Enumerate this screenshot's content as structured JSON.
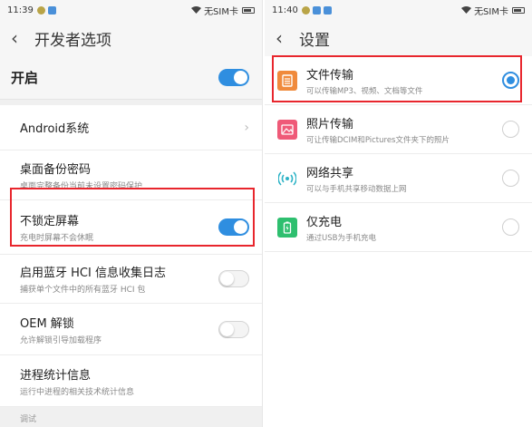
{
  "left": {
    "status": {
      "time": "11:39",
      "sim": "无SIM卡"
    },
    "header": {
      "title": "开发者选项"
    },
    "master": {
      "label": "开启",
      "enabled": true
    },
    "items": [
      {
        "title": "Android系统",
        "subtitle": ""
      },
      {
        "title": "桌面备份密码",
        "subtitle": "桌面完整备份当前未设置密码保护"
      },
      {
        "title": "不锁定屏幕",
        "subtitle": "充电时屏幕不会休眠",
        "enabled": true
      },
      {
        "title": "启用蓝牙 HCI 信息收集日志",
        "subtitle": "捕获单个文件中的所有蓝牙 HCI 包",
        "enabled": false
      },
      {
        "title": "OEM 解锁",
        "subtitle": "允许解锁引导加载程序",
        "enabled": false
      },
      {
        "title": "进程统计信息",
        "subtitle": "运行中进程的相关技术统计信息"
      }
    ],
    "section_label": "调试"
  },
  "right": {
    "status": {
      "time": "11:40",
      "sim": "无SIM卡"
    },
    "header": {
      "title": "设置"
    },
    "options": [
      {
        "title": "文件传输",
        "subtitle": "可以传输MP3、视频、文档等文件",
        "icon": "file-transfer-icon",
        "color": "#f08a3c",
        "selected": true
      },
      {
        "title": "照片传输",
        "subtitle": "可让传输DCIM和Pictures文件夹下的照片",
        "icon": "photo-transfer-icon",
        "color": "#ef5a78",
        "selected": false
      },
      {
        "title": "网络共享",
        "subtitle": "可以与手机共享移动数据上网",
        "icon": "network-share-icon",
        "color": "#ffffff",
        "selected": false
      },
      {
        "title": "仅充电",
        "subtitle": "通过USB为手机充电",
        "icon": "charge-only-icon",
        "color": "#2ebf6f",
        "selected": false
      }
    ]
  },
  "colors": {
    "accent": "#2f8ee0",
    "highlight": "#e8262d"
  }
}
